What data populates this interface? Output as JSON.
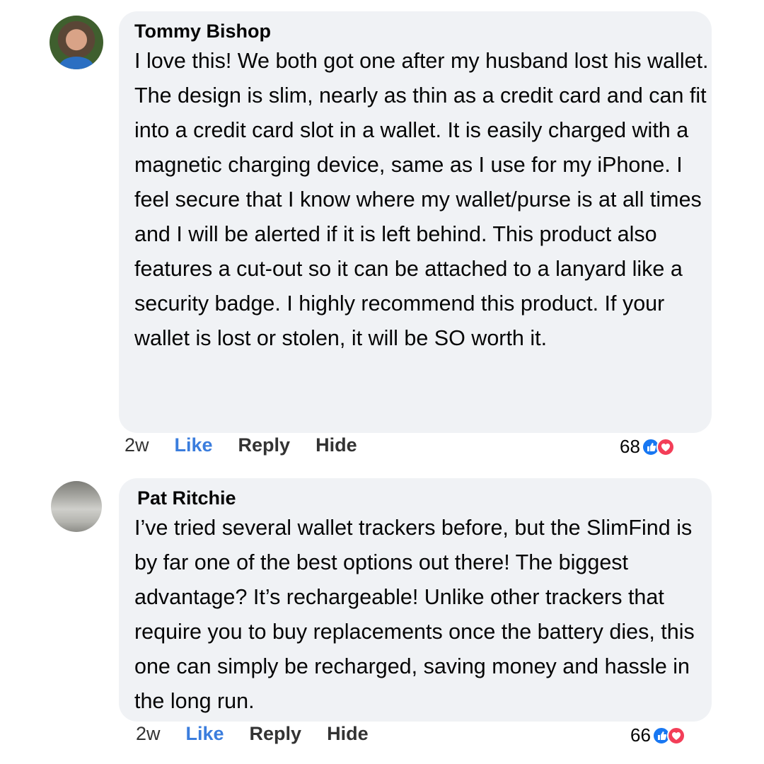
{
  "comments": [
    {
      "author": "Tommy Bishop",
      "text": "I love this! We both got one after my husband lost his wallet. The design is slim, nearly as thin as a credit card and can fit into a credit card slot in a wallet. It is easily charged with a magnetic charging device, same as I use for my iPhone. I feel secure that I know where my wallet/purse is at all times and I will be alerted if it is left behind. This product also features a cut-out so it can be attached to a lanyard like a security badge. I highly recommend this product. If your wallet is lost or stolen, it will be SO worth it.",
      "time": "2w",
      "like_label": "Like",
      "reply_label": "Reply",
      "hide_label": "Hide",
      "reaction_count": "68",
      "reaction_icons": [
        "like-reaction-icon",
        "love-reaction-icon"
      ]
    },
    {
      "author": "Pat Ritchie",
      "text": "I’ve tried several wallet trackers before, but the SlimFind is by far one of the best options out there! The biggest advantage? It’s rechargeable! Unlike other trackers that require you to buy replacements once the battery dies, this one can simply be recharged, saving money and hassle in the long run.",
      "time": "2w",
      "like_label": "Like",
      "reply_label": "Reply",
      "hide_label": "Hide",
      "reaction_count": "66",
      "reaction_icons": [
        "like-reaction-icon",
        "love-reaction-icon"
      ]
    }
  ],
  "colors": {
    "bubble": "#f0f2f5",
    "like_link": "#3b7ddd",
    "like_reaction": "#1877f2",
    "love_reaction": "#f33e58"
  }
}
